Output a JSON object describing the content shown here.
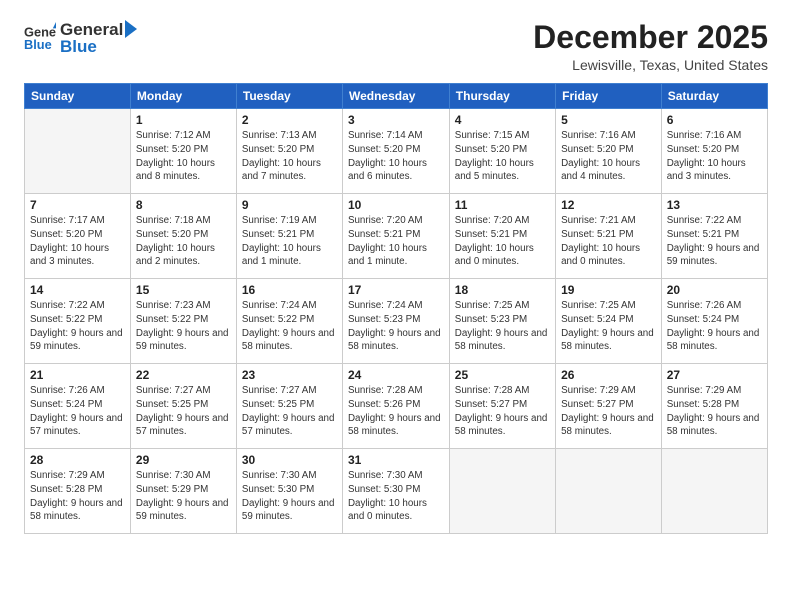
{
  "header": {
    "logo_general": "General",
    "logo_blue": "Blue",
    "month_title": "December 2025",
    "location": "Lewisville, Texas, United States"
  },
  "weekdays": [
    "Sunday",
    "Monday",
    "Tuesday",
    "Wednesday",
    "Thursday",
    "Friday",
    "Saturday"
  ],
  "weeks": [
    [
      {
        "day": "",
        "empty": true
      },
      {
        "day": "1",
        "sunrise": "7:12 AM",
        "sunset": "5:20 PM",
        "daylight": "10 hours and 8 minutes."
      },
      {
        "day": "2",
        "sunrise": "7:13 AM",
        "sunset": "5:20 PM",
        "daylight": "10 hours and 7 minutes."
      },
      {
        "day": "3",
        "sunrise": "7:14 AM",
        "sunset": "5:20 PM",
        "daylight": "10 hours and 6 minutes."
      },
      {
        "day": "4",
        "sunrise": "7:15 AM",
        "sunset": "5:20 PM",
        "daylight": "10 hours and 5 minutes."
      },
      {
        "day": "5",
        "sunrise": "7:16 AM",
        "sunset": "5:20 PM",
        "daylight": "10 hours and 4 minutes."
      },
      {
        "day": "6",
        "sunrise": "7:16 AM",
        "sunset": "5:20 PM",
        "daylight": "10 hours and 3 minutes."
      }
    ],
    [
      {
        "day": "7",
        "sunrise": "7:17 AM",
        "sunset": "5:20 PM",
        "daylight": "10 hours and 3 minutes."
      },
      {
        "day": "8",
        "sunrise": "7:18 AM",
        "sunset": "5:20 PM",
        "daylight": "10 hours and 2 minutes."
      },
      {
        "day": "9",
        "sunrise": "7:19 AM",
        "sunset": "5:21 PM",
        "daylight": "10 hours and 1 minute."
      },
      {
        "day": "10",
        "sunrise": "7:20 AM",
        "sunset": "5:21 PM",
        "daylight": "10 hours and 1 minute."
      },
      {
        "day": "11",
        "sunrise": "7:20 AM",
        "sunset": "5:21 PM",
        "daylight": "10 hours and 0 minutes."
      },
      {
        "day": "12",
        "sunrise": "7:21 AM",
        "sunset": "5:21 PM",
        "daylight": "10 hours and 0 minutes."
      },
      {
        "day": "13",
        "sunrise": "7:22 AM",
        "sunset": "5:21 PM",
        "daylight": "9 hours and 59 minutes."
      }
    ],
    [
      {
        "day": "14",
        "sunrise": "7:22 AM",
        "sunset": "5:22 PM",
        "daylight": "9 hours and 59 minutes."
      },
      {
        "day": "15",
        "sunrise": "7:23 AM",
        "sunset": "5:22 PM",
        "daylight": "9 hours and 59 minutes."
      },
      {
        "day": "16",
        "sunrise": "7:24 AM",
        "sunset": "5:22 PM",
        "daylight": "9 hours and 58 minutes."
      },
      {
        "day": "17",
        "sunrise": "7:24 AM",
        "sunset": "5:23 PM",
        "daylight": "9 hours and 58 minutes."
      },
      {
        "day": "18",
        "sunrise": "7:25 AM",
        "sunset": "5:23 PM",
        "daylight": "9 hours and 58 minutes."
      },
      {
        "day": "19",
        "sunrise": "7:25 AM",
        "sunset": "5:24 PM",
        "daylight": "9 hours and 58 minutes."
      },
      {
        "day": "20",
        "sunrise": "7:26 AM",
        "sunset": "5:24 PM",
        "daylight": "9 hours and 58 minutes."
      }
    ],
    [
      {
        "day": "21",
        "sunrise": "7:26 AM",
        "sunset": "5:24 PM",
        "daylight": "9 hours and 57 minutes."
      },
      {
        "day": "22",
        "sunrise": "7:27 AM",
        "sunset": "5:25 PM",
        "daylight": "9 hours and 57 minutes."
      },
      {
        "day": "23",
        "sunrise": "7:27 AM",
        "sunset": "5:25 PM",
        "daylight": "9 hours and 57 minutes."
      },
      {
        "day": "24",
        "sunrise": "7:28 AM",
        "sunset": "5:26 PM",
        "daylight": "9 hours and 58 minutes."
      },
      {
        "day": "25",
        "sunrise": "7:28 AM",
        "sunset": "5:27 PM",
        "daylight": "9 hours and 58 minutes."
      },
      {
        "day": "26",
        "sunrise": "7:29 AM",
        "sunset": "5:27 PM",
        "daylight": "9 hours and 58 minutes."
      },
      {
        "day": "27",
        "sunrise": "7:29 AM",
        "sunset": "5:28 PM",
        "daylight": "9 hours and 58 minutes."
      }
    ],
    [
      {
        "day": "28",
        "sunrise": "7:29 AM",
        "sunset": "5:28 PM",
        "daylight": "9 hours and 58 minutes."
      },
      {
        "day": "29",
        "sunrise": "7:30 AM",
        "sunset": "5:29 PM",
        "daylight": "9 hours and 59 minutes."
      },
      {
        "day": "30",
        "sunrise": "7:30 AM",
        "sunset": "5:30 PM",
        "daylight": "9 hours and 59 minutes."
      },
      {
        "day": "31",
        "sunrise": "7:30 AM",
        "sunset": "5:30 PM",
        "daylight": "10 hours and 0 minutes."
      },
      {
        "day": "",
        "empty": true
      },
      {
        "day": "",
        "empty": true
      },
      {
        "day": "",
        "empty": true
      }
    ]
  ],
  "labels": {
    "sunrise": "Sunrise:",
    "sunset": "Sunset:",
    "daylight": "Daylight:"
  }
}
